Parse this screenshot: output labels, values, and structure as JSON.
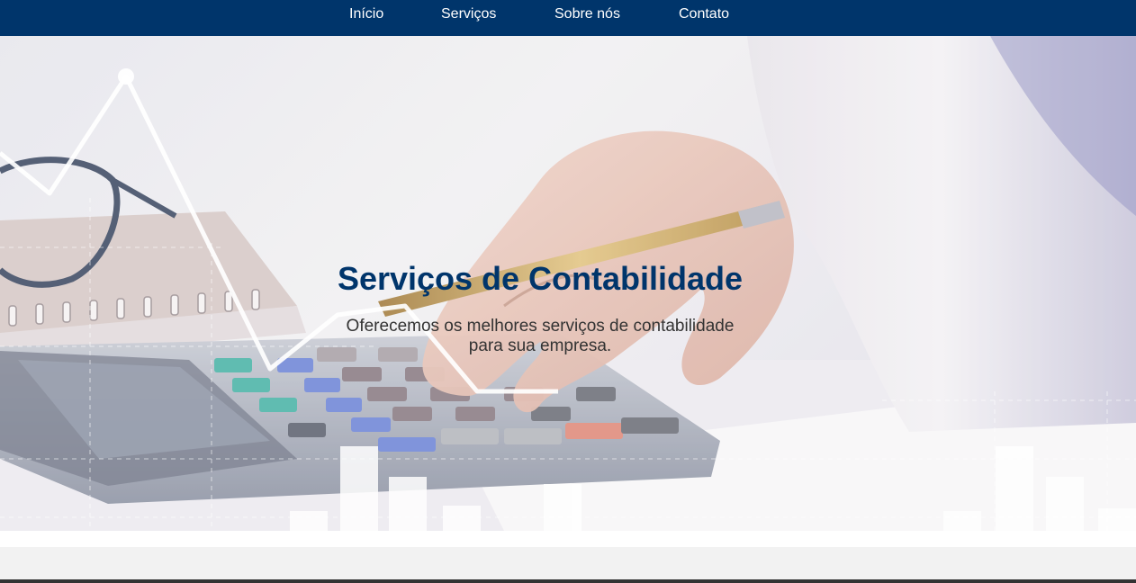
{
  "nav": {
    "items": [
      {
        "label": "Início"
      },
      {
        "label": "Serviços"
      },
      {
        "label": "Sobre nós"
      },
      {
        "label": "Contato"
      }
    ],
    "background": "#00356b"
  },
  "hero": {
    "title": "Serviços de Contabilidade",
    "subtitle": "Oferecemos os melhores serviços de contabilidade para sua empresa.",
    "title_color": "#00356b",
    "image": "calculator-hand-pen-photo"
  },
  "colors": {
    "section_band": "#f2f2f2",
    "footer_edge": "#333333"
  }
}
